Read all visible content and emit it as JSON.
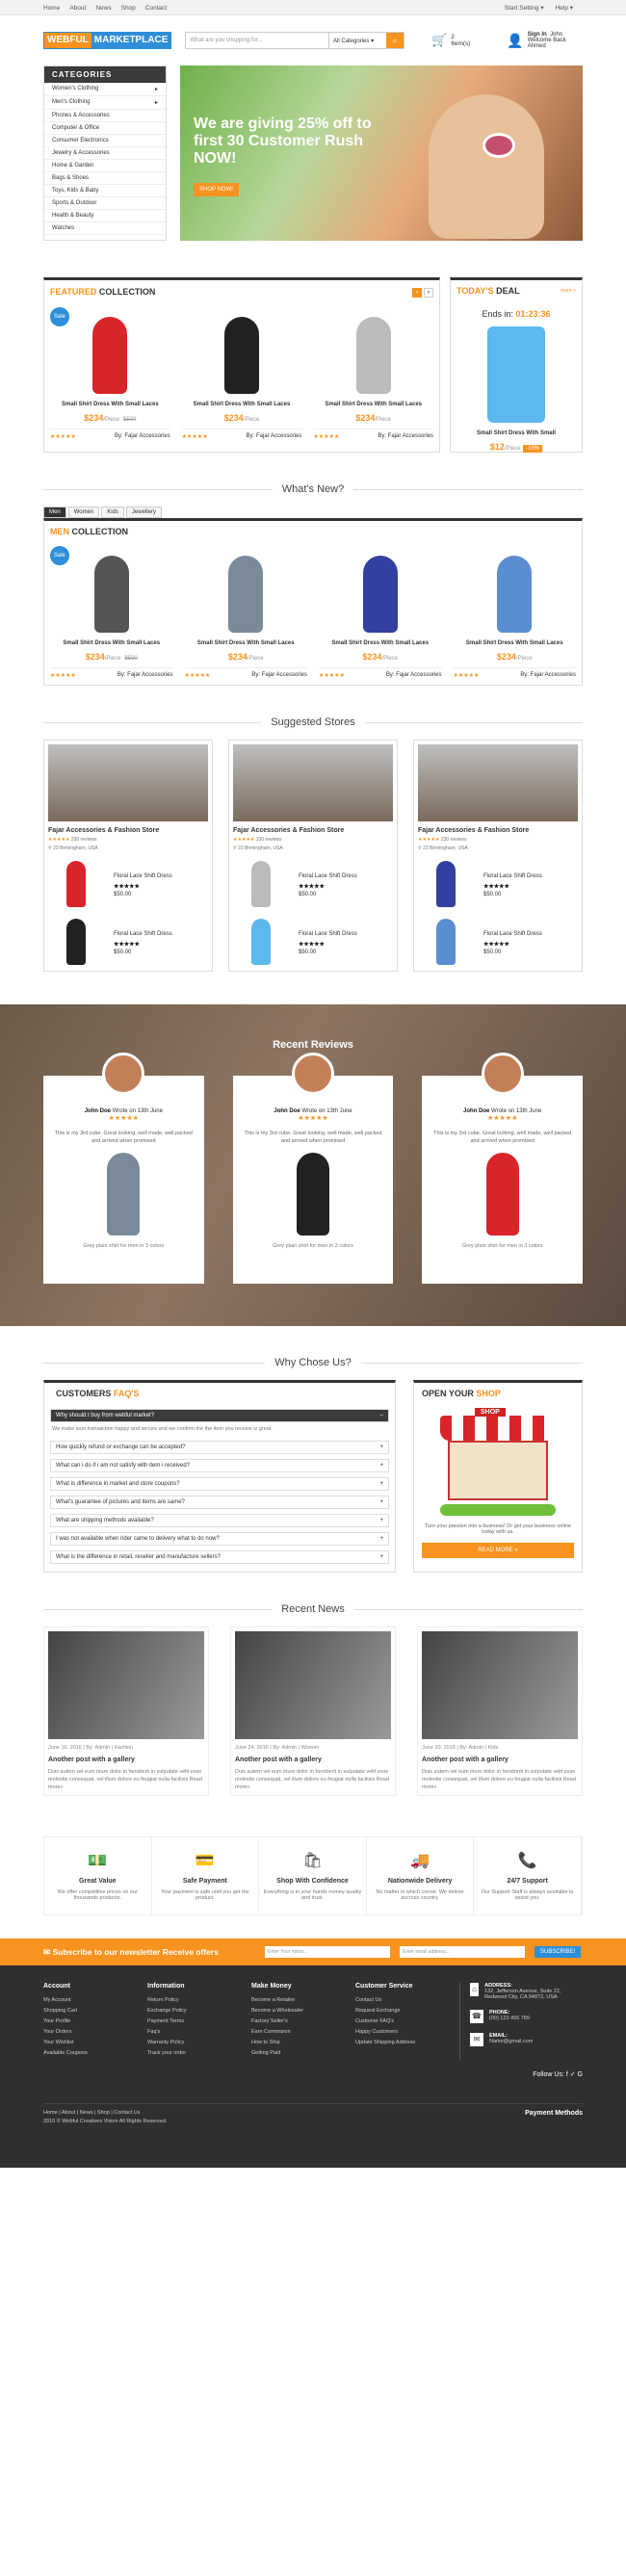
{
  "topbar": {
    "nav": [
      "Home",
      "About",
      "News",
      "Shop",
      "Contact"
    ],
    "settings": "Start Setting ▾",
    "help": "Help ▾"
  },
  "header": {
    "logo_a": "WEBFUL",
    "logo_b": "MARKETPLACE",
    "search_placeholder": "What are you shopping for...",
    "category": "All Categories",
    "cart": "2 Item(s)",
    "signin": "Sign In",
    "welcome": "Welcome Back Ahmed",
    "user": "John"
  },
  "categories": {
    "title": "CATEGORIES",
    "items": [
      "Women's Clothing",
      "Men's Clothing",
      "Phones & Accessories",
      "Computer & Office",
      "Consumer Electronics",
      "Jewelry & Accessories",
      "Home & Garden",
      "Bags & Shoes",
      "Toys, Kids & Baby",
      "Sports & Outdoor",
      "Health & Beauty",
      "Watches"
    ]
  },
  "banner": {
    "text": "We are giving 25% off to first 30 Customer Rush NOW!",
    "button": "SHOP NOW!"
  },
  "featured": {
    "title_a": "FEATURED",
    "title_b": "COLLECTION",
    "sale": "Sale",
    "products": [
      {
        "name": "Small Shirt Dress With Small Laces",
        "price": "$234",
        "unit": "/Piece",
        "old": "$500",
        "by": "By: Fajar Accessories",
        "color": "#d9242a"
      },
      {
        "name": "Small Shirt Dress With Small Laces",
        "price": "$234",
        "unit": "/Piece",
        "old": "",
        "by": "By: Fajar Accessories",
        "color": "#222"
      },
      {
        "name": "Small Shirt Dress With Small Laces",
        "price": "$234",
        "unit": "/Piece",
        "old": "",
        "by": "By: Fajar Accessories",
        "color": "#bbb"
      }
    ],
    "stars": "★★★★★"
  },
  "deal": {
    "title_a": "TODAY'S",
    "title_b": "DEAL",
    "more": "more >",
    "ends_label": "Ends in:",
    "timer": "01:23:36",
    "name": "Small Shirt Dress With Small",
    "price": "$12",
    "unit": "/Piece",
    "off": "-15%"
  },
  "whatsnew": {
    "title": "What's New?",
    "tabs": [
      "Men",
      "Women",
      "Kids",
      "Jewellery"
    ],
    "title_a": "MEN",
    "title_b": "COLLECTION",
    "products": [
      {
        "name": "Small Shirt Dress With Small Laces",
        "price": "$234",
        "unit": "/Piece",
        "old": "$500",
        "by": "By: Fajar Accessories",
        "color": "#555"
      },
      {
        "name": "Small Shirt Dress With Small Laces",
        "price": "$234",
        "unit": "/Piece",
        "old": "",
        "by": "By: Fajar Accessories",
        "color": "#7a8a9a"
      },
      {
        "name": "Small Shirt Dress With Small Laces",
        "price": "$234",
        "unit": "/Piece",
        "old": "",
        "by": "By: Fajar Accessories",
        "color": "#3340a0"
      },
      {
        "name": "Small Shirt Dress With Small Laces",
        "price": "$234",
        "unit": "/Piece",
        "old": "",
        "by": "By: Fajar Accessories",
        "color": "#5a8ed0"
      }
    ]
  },
  "stores": {
    "title": "Suggested Stores",
    "list": [
      {
        "name": "Fajar Accessories & Fashion Store",
        "reviews": "230 reviews",
        "loc": "23 Birmingham, USA",
        "items": [
          {
            "name": "Floral Lace Shift Dress",
            "price": "$50.00",
            "color": "#d9242a"
          },
          {
            "name": "Floral Lace Shift Dress",
            "price": "$50.00",
            "color": "#222"
          }
        ]
      },
      {
        "name": "Fajar Accessories & Fashion Store",
        "reviews": "230 reviews",
        "loc": "23 Birmingham, USA",
        "items": [
          {
            "name": "Floral Lace Shift Dress",
            "price": "$50.00",
            "color": "#bbb"
          },
          {
            "name": "Floral Lace Shift Dress",
            "price": "$50.00",
            "color": "#5db8ee"
          }
        ]
      },
      {
        "name": "Fajar Accessories & Fashion Store",
        "reviews": "230 reviews",
        "loc": "23 Birmingham, USA",
        "items": [
          {
            "name": "Floral Lace Shift Dress",
            "price": "$50.00",
            "color": "#3340a0"
          },
          {
            "name": "Floral Lace Shift Dress",
            "price": "$50.00",
            "color": "#5a8ed0"
          }
        ]
      }
    ]
  },
  "reviews": {
    "title": "Recent Reviews",
    "list": [
      {
        "name": "John Doe",
        "date": "Wrote on 13th June",
        "text": "This is my 3rd cube. Great looking, well made, well packed and arrived when promised",
        "caption": "Grey plain shirt for men in 3 colors",
        "color": "#7a8a9a"
      },
      {
        "name": "John Doe",
        "date": "Wrote on 13th June",
        "text": "This is my 3rd cube. Great looking, well made, well packed and arrived when promised",
        "caption": "Grey plain shirt for men in 3 colors",
        "color": "#222"
      },
      {
        "name": "John Doe",
        "date": "Wrote on 13th June",
        "text": "This is my 3rd cube. Great looking, well made, well packed and arrived when promised",
        "caption": "Grey plain shirt for men in 3 colors",
        "color": "#d9242a"
      }
    ]
  },
  "why": {
    "title": "Why Chose Us?",
    "faq_a": "CUSTOMERS",
    "faq_b": "FAQ'S",
    "faq": [
      "Why should I buy from webful market?",
      "How quickly refund or exchange can be accepted?",
      "What can i do if i am not satisfy with item i received?",
      "What is difference in market and store coupons?",
      "What's guarantee of pictures and items are same?",
      "What are shipping methods available?",
      "I was not available when rider came to delivery what to do now?",
      "What is the difference in retail, reseller and manufacture sellers?"
    ],
    "answer": "We make sure transaction happy and secure and we confirm the the item you receive is great.",
    "shop_a": "OPEN YOUR",
    "shop_b": "SHOP",
    "shop_sign": "SHOP",
    "shop_text": "Turn your passion into a business! Or get your business online today with us.",
    "shop_btn": "READ MORE »"
  },
  "news": {
    "title": "Recent News",
    "list": [
      {
        "meta": "June 16, 2016 | By: Admin | Fashion",
        "title": "Another post with a gallery",
        "text": "Duis autem vel eum iriure dolor in hendrerit in vulputate velit esse molestie consequat, vel illum dolore eu feugiat nulla facilisis Read more»"
      },
      {
        "meta": "June 24, 2016 | By: Admin | Women",
        "title": "Another post with a gallery",
        "text": "Duis autem vel eum iriure dolor in hendrerit in vulputate velit esse molestie consequat, vel illum dolore eu feugiat nulla facilisis Read more»"
      },
      {
        "meta": "June 20, 2016 | By: Admin | Kids",
        "title": "Another post with a gallery",
        "text": "Duis autem vel eum iriure dolor in hendrerit in vulputate velit esse molestie consequat, vel illum dolore eu feugiat nulla facilisis Read more»"
      }
    ]
  },
  "features": [
    {
      "icon": "💵",
      "title": "Great Value",
      "text": "We offer competitive prices on our thousands products."
    },
    {
      "icon": "💳",
      "title": "Safe Payment",
      "text": "Your payment is safe until you get the product."
    },
    {
      "icon": "🛍",
      "title": "Shop With Confidence",
      "text": "Everything is in your hands money quality and trust."
    },
    {
      "icon": "🚚",
      "title": "Nationwide Delivery",
      "text": "No matter in which corner. We deliver accross country."
    },
    {
      "icon": "📞",
      "title": "24/7 Support",
      "text": "Our Support Staff is always available to assist you."
    }
  ],
  "newsletter": {
    "title": "Subscribe to our newsletter Receive offers",
    "name_ph": "Enter Your name...",
    "email_ph": "Enter email address...",
    "button": "SUBSCRIBE!"
  },
  "footer": {
    "cols": [
      {
        "title": "Account",
        "items": [
          "My Account",
          "Shopping Cart",
          "Your Profile",
          "Your Orders",
          "Your Wishlist",
          "Available Coupons"
        ]
      },
      {
        "title": "Information",
        "items": [
          "Return Policy",
          "Exchange Policy",
          "Payment Terms",
          "Faq's",
          "Warranty Policy",
          "Track your order"
        ]
      },
      {
        "title": "Make Money",
        "items": [
          "Become a Retailer",
          "Become a Wholesaler",
          "Factory Seller's",
          "Earn Commision",
          "How to Ship",
          "Getting Paid"
        ]
      },
      {
        "title": "Customer Service",
        "items": [
          "Contact Us",
          "Request Exchange",
          "Customer FAQ's",
          "Happy Customers",
          "Update Shipping Address"
        ]
      }
    ],
    "address_t": "ADDRESS:",
    "address": "132, Jefferson Avenue, Suite 22, Redwood City, CA 94872, USA",
    "phone_t": "PHONE:",
    "phone": "(00) 123 456 789",
    "email_t": "EMAIL:",
    "email": "Name@gmail.com",
    "follow": "Follow Us:  f  ✓  G",
    "bottom_nav": "Home  |  About  |  News  |  Shop  |  Contact Us",
    "copyright": "2016 © Webful Creatives Vision All Rights Reserved.",
    "payment": "Payment Methods"
  }
}
